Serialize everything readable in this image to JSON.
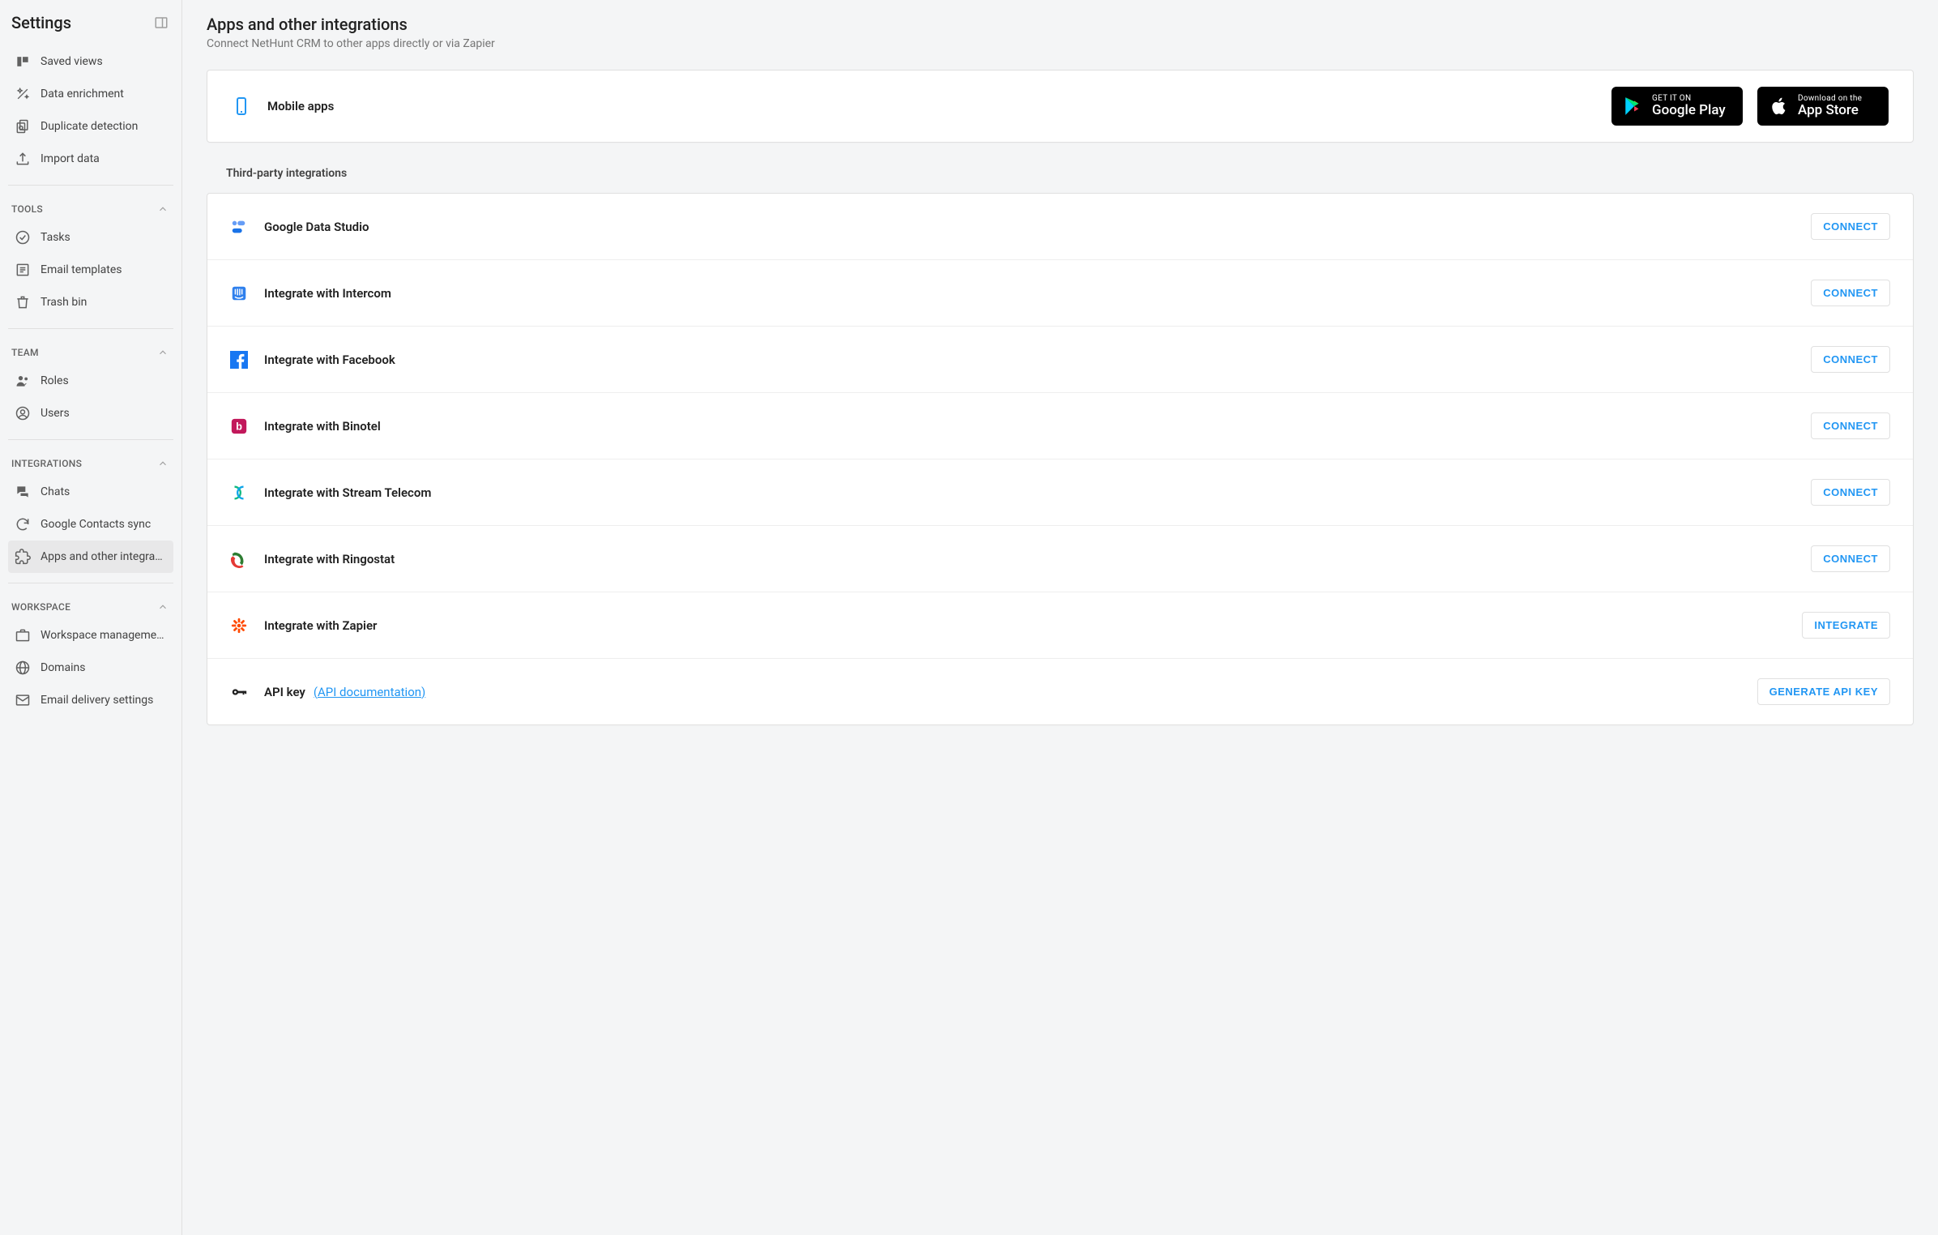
{
  "sidebar": {
    "title": "Settings",
    "top_items": [
      {
        "label": "Saved views",
        "icon": "saved-views"
      },
      {
        "label": "Data enrichment",
        "icon": "enrichment"
      },
      {
        "label": "Duplicate detection",
        "icon": "duplicate"
      },
      {
        "label": "Import data",
        "icon": "import"
      }
    ],
    "sections": [
      {
        "title": "TOOLS",
        "items": [
          {
            "label": "Tasks",
            "icon": "tasks"
          },
          {
            "label": "Email templates",
            "icon": "templates"
          },
          {
            "label": "Trash bin",
            "icon": "trash"
          }
        ]
      },
      {
        "title": "TEAM",
        "items": [
          {
            "label": "Roles",
            "icon": "roles"
          },
          {
            "label": "Users",
            "icon": "users"
          }
        ]
      },
      {
        "title": "INTEGRATIONS",
        "items": [
          {
            "label": "Chats",
            "icon": "chats"
          },
          {
            "label": "Google Contacts sync",
            "icon": "sync"
          },
          {
            "label": "Apps and other integra…",
            "icon": "apps",
            "active": true
          }
        ]
      },
      {
        "title": "WORKSPACE",
        "items": [
          {
            "label": "Workspace manageme…",
            "icon": "workspace"
          },
          {
            "label": "Domains",
            "icon": "domains"
          },
          {
            "label": "Email delivery settings",
            "icon": "email-delivery"
          }
        ]
      }
    ]
  },
  "page": {
    "title": "Apps and other integrations",
    "subtitle": "Connect NetHunt CRM to other apps directly or via Zapier"
  },
  "mobile": {
    "label": "Mobile apps",
    "google": {
      "top": "GET IT ON",
      "bottom": "Google Play"
    },
    "apple": {
      "top": "Download on the",
      "bottom": "App Store"
    }
  },
  "third_party": {
    "heading": "Third-party integrations",
    "rows": [
      {
        "label": "Google Data Studio",
        "icon": "data-studio",
        "action": "CONNECT"
      },
      {
        "label": "Integrate with Intercom",
        "icon": "intercom",
        "action": "CONNECT"
      },
      {
        "label": "Integrate with Facebook",
        "icon": "facebook",
        "action": "CONNECT"
      },
      {
        "label": "Integrate with Binotel",
        "icon": "binotel",
        "action": "CONNECT"
      },
      {
        "label": "Integrate with Stream Telecom",
        "icon": "stream-telecom",
        "action": "CONNECT"
      },
      {
        "label": "Integrate with Ringostat",
        "icon": "ringostat",
        "action": "CONNECT"
      },
      {
        "label": "Integrate with Zapier",
        "icon": "zapier",
        "action": "INTEGRATE"
      },
      {
        "label": "API key",
        "link": "(API documentation)",
        "icon": "api-key",
        "action": "GENERATE API KEY"
      }
    ]
  }
}
